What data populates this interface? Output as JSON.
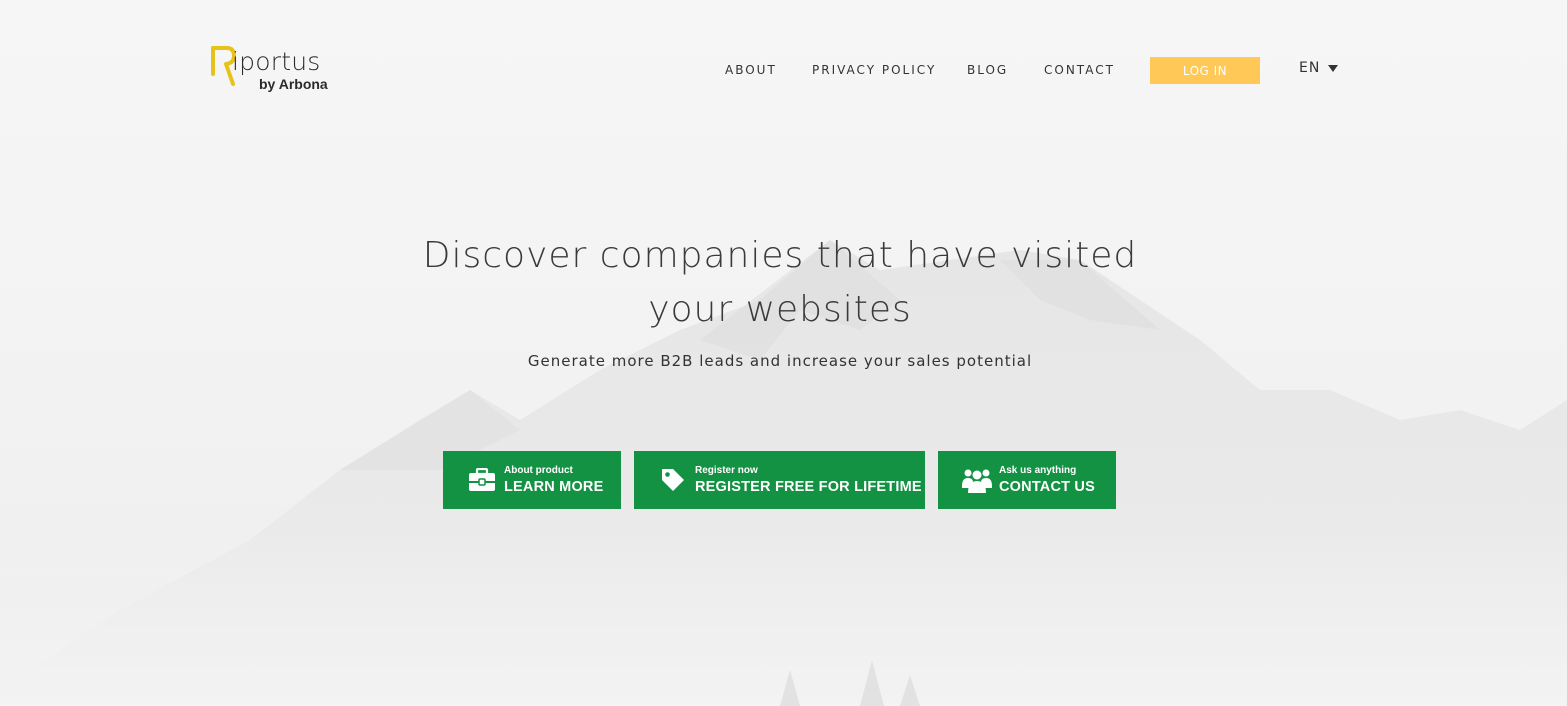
{
  "brand": {
    "name": "iportus",
    "by": "by Arbona",
    "mark_color": "#e7c21a"
  },
  "nav": {
    "items": [
      {
        "label": "ABOUT"
      },
      {
        "label": "PRIVACY POLICY"
      },
      {
        "label": "BLOG"
      },
      {
        "label": "CONTACT"
      }
    ],
    "login_label": "LOG IN",
    "language": "EN"
  },
  "hero": {
    "title": "Discover companies that have visited your websites",
    "subtitle": "Generate more B2B leads and increase your sales potential"
  },
  "cta": [
    {
      "small": "About product",
      "big": "LEARN MORE",
      "icon": "briefcase-icon"
    },
    {
      "small": "Register now",
      "big": "REGISTER FREE FOR LIFETIME",
      "icon": "tag-icon"
    },
    {
      "small": "Ask us anything",
      "big": "CONTACT US",
      "icon": "users-icon"
    }
  ],
  "colors": {
    "primary_green": "#149244",
    "login_yellow": "#ffc857",
    "text_dark": "#333333"
  }
}
